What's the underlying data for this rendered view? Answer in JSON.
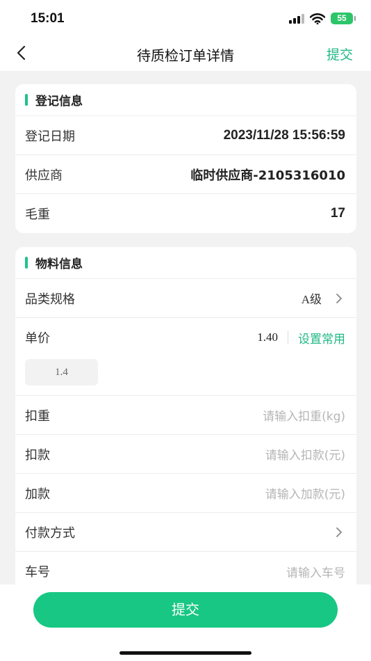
{
  "status_bar": {
    "time": "15:01",
    "battery": "55"
  },
  "nav": {
    "title": "待质检订单详情",
    "submit_label": "提交"
  },
  "registration": {
    "title": "登记信息",
    "rows": [
      {
        "label": "登记日期",
        "value": "2023/11/28 15:56:59"
      },
      {
        "label": "供应商",
        "value": "临时供应商-2105316010"
      },
      {
        "label": "毛重",
        "value": "17"
      }
    ]
  },
  "material": {
    "title": "物料信息",
    "category": {
      "label": "品类规格",
      "value": "A级"
    },
    "price": {
      "label": "单价",
      "value": "1.40",
      "set_common_label": "设置常用",
      "input_value": "1.4"
    },
    "deduct_weight": {
      "label": "扣重",
      "placeholder": "请输入扣重(kg)"
    },
    "deduct_amount": {
      "label": "扣款",
      "placeholder": "请输入扣款(元)"
    },
    "add_amount": {
      "label": "加款",
      "placeholder": "请输入加款(元)"
    },
    "payment_method": {
      "label": "付款方式",
      "value": ""
    },
    "plate_number": {
      "label": "车号",
      "placeholder": "请输入车号"
    }
  },
  "footer": {
    "submit_label": "提交"
  },
  "colors": {
    "accent": "#1fb885",
    "button": "#18c783",
    "battery": "#2dc56a"
  },
  "icons": [
    "back-icon",
    "chevron-right-icon",
    "signal-icon",
    "wifi-icon",
    "battery-icon"
  ]
}
